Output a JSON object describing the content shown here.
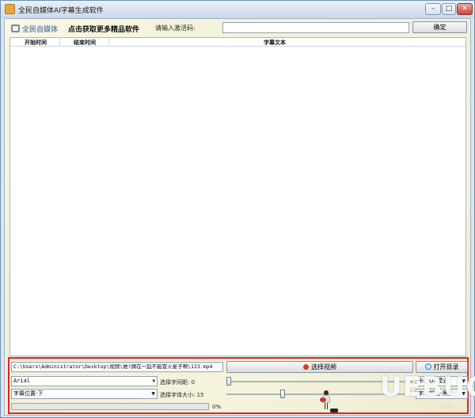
{
  "window": {
    "title": "全民自媒体AI字幕生成软件",
    "controls": {
      "minimize": "–",
      "maximize": "□",
      "close": "✕"
    }
  },
  "header": {
    "logo_text": "全民自媒体",
    "promo_link": "点击获取更多精品软件",
    "code_label": "请输入激活码:",
    "code_value": "",
    "confirm_label": "确定"
  },
  "subtitle_list": {
    "columns": [
      "开始时间",
      "结束时间",
      "字幕文本"
    ],
    "rows": []
  },
  "controls": {
    "video_path": "C:\\Users\\Administrator\\Desktop\\视频\\她?俩在一起不能冒火星子啊\\123.mp4",
    "choose_video_label": "选择视频",
    "open_dir_label": "打开目录",
    "font_value": "Arial",
    "spacing_label": "选择字间距: 0",
    "spacing_level": 0,
    "mode_value": "卡拉OK模式",
    "position_value": "字幕位置-下",
    "size_label": "选择字体大小: 15",
    "size_level": 0.3,
    "color_value": "字幕颜色-黑色",
    "progress_percent": 0,
    "progress_label": "0%"
  },
  "watermark": {
    "main": "UEBUG",
    "sub": ".com"
  },
  "colors": {
    "highlight_border": "#e0222a",
    "accent": "#6b8eb1"
  }
}
